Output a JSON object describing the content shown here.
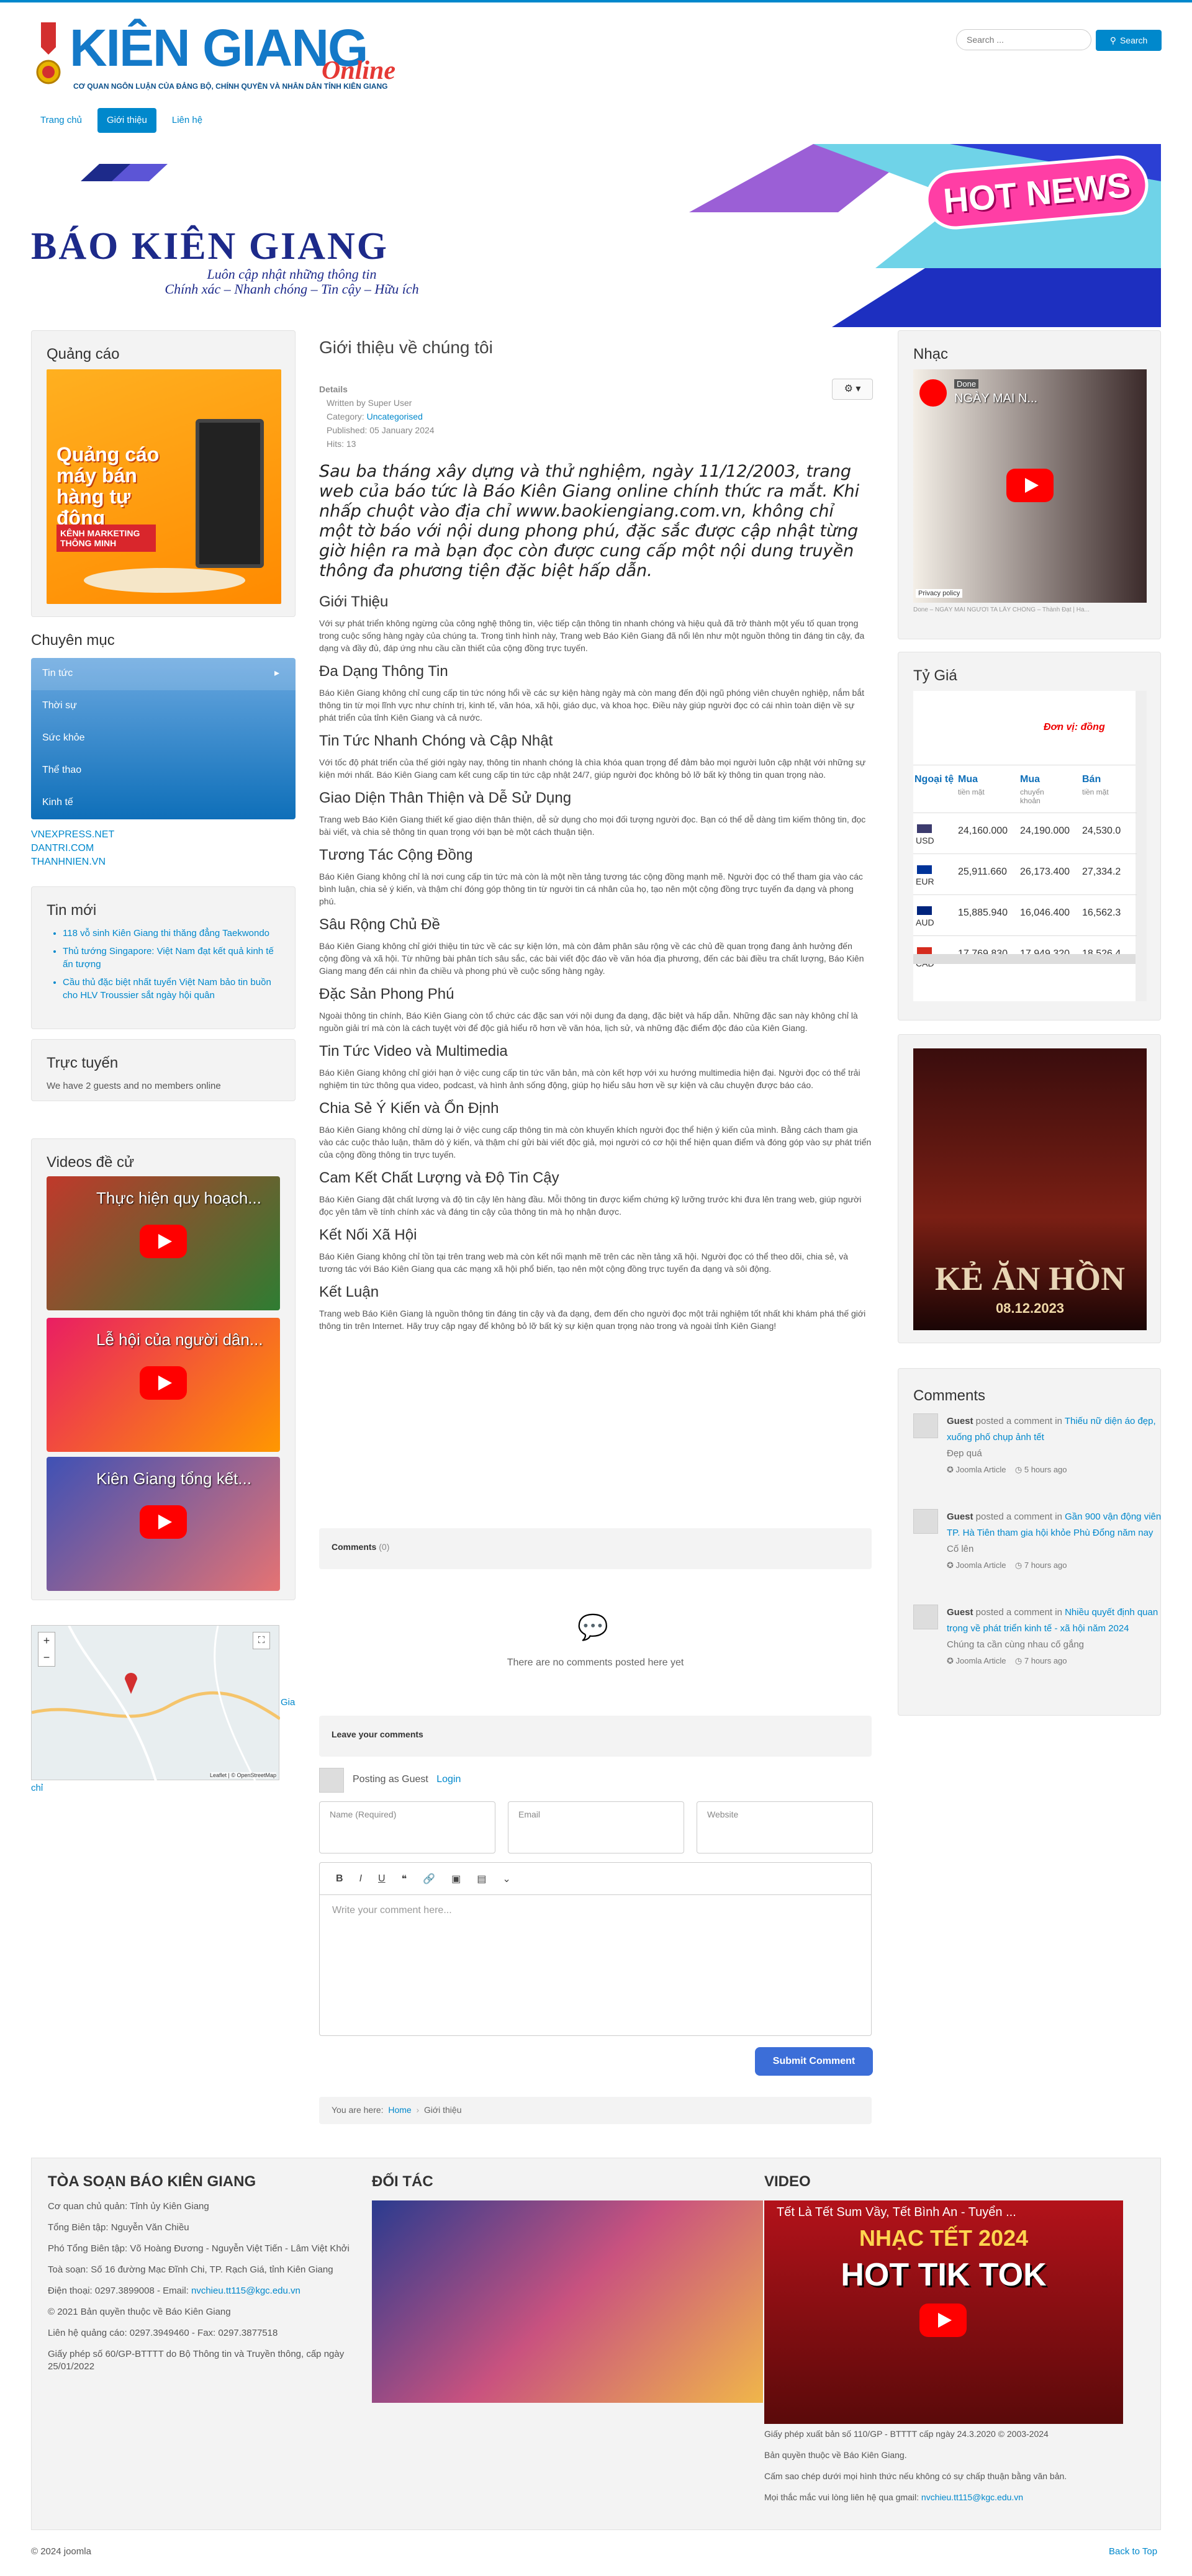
{
  "header": {
    "logo_text": "KIÊN GIANG",
    "logo_online": "Online",
    "logo_subtitle": "CƠ QUAN NGÔN LUẬN CỦA ĐẢNG BỘ, CHÍNH QUYỀN VÀ NHÂN DÂN TỈNH KIÊN GIANG",
    "search_placeholder": "Search ...",
    "search_button": "Search"
  },
  "nav": {
    "items": [
      "Trang chủ",
      "Giới thiệu",
      "Liên hệ"
    ],
    "active": "Giới thiệu"
  },
  "banner": {
    "title": "BÁO KIÊN GIANG",
    "line1": "Luôn cập nhật những thông tin",
    "line2": "Chính xác – Nhanh chóng – Tin cậy – Hữu ích",
    "hot": "HOT NEWS"
  },
  "left": {
    "ads_title": "Quảng cáo",
    "ads_image_text": "Quảng cáo máy bán hàng tự động",
    "ads_image_sub": "KÊNH MARKETING THÔNG MINH",
    "categories_title": "Chuyên mục",
    "categories": [
      "Tin tức",
      "Thời sự",
      "Sức khỏe",
      "Thể thao",
      "Kinh tế"
    ],
    "links": [
      "VNEXPRESS.NET",
      "DANTRI.COM",
      "THANHNIEN.VN"
    ],
    "news_title": "Tin mới",
    "news": [
      "118 vỗ sinh Kiên Giang thi thăng đẳng Taekwondo",
      "Thủ tướng Singapore: Việt Nam đạt kết quả kinh tế ấn tượng",
      "Cầu thủ đặc biệt nhất tuyển Việt Nam bảo tin buồn cho HLV Troussier sắt ngày hội quân"
    ],
    "online_title": "Trực tuyến",
    "online_text": "We have 2 guests and no members online",
    "videos_title": "Videos đề cử",
    "videos": [
      "Thực hiện quy hoạch...",
      "Lễ hội của người dân...",
      "Kiên Giang tổng kết..."
    ],
    "map_label": "Gia",
    "map_label2": "chỉ",
    "map_attr": "Leaflet | © OpenStreetMap"
  },
  "article": {
    "title": "Giới thiệu về chúng tôi",
    "details_label": "Details",
    "written_by": "Written by Super User",
    "category_label": "Category: ",
    "category": "Uncategorised",
    "published": "Published: 05 January 2024",
    "hits": "Hits: 13",
    "intro": "Sau ba tháng xây dựng và thử nghiệm, ngày 11/12/2003, trang web của báo tức là Báo Kiên Giang online chính thức ra mắt. Khi nhấp chuột vào địa chỉ www.baokiengiang.com.vn, không chỉ một tờ báo với nội dung phong phú, đặc sắc được cập nhật từng giờ hiện ra mà bạn đọc còn được cung cấp một nội dung truyền thông đa phương tiện đặc biệt hấp dẫn.",
    "sections": [
      {
        "h": "Giới Thiệu",
        "p": "Với sự phát triển không ngừng của công nghệ thông tin, việc tiếp cận thông tin nhanh chóng và hiệu quả đã trở thành một yếu tố quan trọng trong cuộc sống hàng ngày của chúng ta. Trong tình hình này, Trang web Báo Kiên Giang đã nổi lên như một nguồn thông tin đáng tin cậy, đa dạng và đầy đủ, đáp ứng nhu cầu cần thiết của cộng đồng trực tuyến."
      },
      {
        "h": "Đa Dạng Thông Tin",
        "p": "Báo Kiên Giang không chỉ cung cấp tin tức nóng hổi về các sự kiện hàng ngày mà còn mang đến đội ngũ phóng viên chuyên nghiệp, nắm bắt thông tin từ mọi lĩnh vực như chính trị, kinh tế, văn hóa, xã hội, giáo dục, và khoa học. Điều này giúp người đọc có cái nhìn toàn diện về sự phát triển của tỉnh Kiên Giang và cả nước."
      },
      {
        "h": "Tin Tức Nhanh Chóng và Cập Nhật",
        "p": "Với tốc độ phát triển của thế giới ngày nay, thông tin nhanh chóng là chìa khóa quan trọng để đảm bảo mọi người luôn cập nhật với những sự kiện mới nhất. Báo Kiên Giang cam kết cung cấp tin tức cập nhật 24/7, giúp người đọc không bỏ lỡ bất kỳ thông tin quan trọng nào."
      },
      {
        "h": "Giao Diện Thân Thiện và Dễ Sử Dụng",
        "p": "Trang web Báo Kiên Giang thiết kế giao diện thân thiện, dễ sử dụng cho mọi đối tượng người đọc. Bạn có thể dễ dàng tìm kiếm thông tin, đọc bài viết, và chia sẻ thông tin quan trọng với bạn bè một cách thuận tiện."
      },
      {
        "h": "Tương Tác Cộng Đồng",
        "p": "Báo Kiên Giang không chỉ là nơi cung cấp tin tức mà còn là một nền tảng tương tác cộng đồng mạnh mẽ. Người đọc có thể tham gia vào các bình luận, chia sẻ ý kiến, và thậm chí đóng góp thông tin từ người tin cá nhân của họ, tạo nên một cộng đồng trực tuyến đa dạng và phong phú."
      },
      {
        "h": "Sâu Rộng Chủ Đề",
        "p": "Báo Kiên Giang không chỉ giới thiệu tin tức về các sự kiện lớn, mà còn đảm phân sâu rộng về các chủ đề quan trọng đang ảnh hưởng đến cộng đồng và xã hội. Từ những bài phân tích sâu sắc, các bài viết độc đáo về văn hóa địa phương, đến các bài điều tra chất lượng, Báo Kiên Giang mang đến cái nhìn đa chiều và phong phú về cuộc sống hàng ngày."
      },
      {
        "h": "Đặc Sản Phong Phú",
        "p": "Ngoài thông tin chính, Báo Kiên Giang còn tổ chức các đặc san với nội dung đa dạng, đặc biệt và hấp dẫn. Những đặc san này không chỉ là nguồn giải trí mà còn là cách tuyệt vời để độc giả hiểu rõ hơn về văn hóa, lịch sử, và những đặc điểm độc đáo của Kiên Giang."
      },
      {
        "h": "Tin Tức Video và Multimedia",
        "p": "Báo Kiên Giang không chỉ giới hạn ở việc cung cấp tin tức văn bản, mà còn kết hợp với xu hướng multimedia hiện đại. Người đọc có thể trải nghiệm tin tức thông qua video, podcast, và hình ảnh sống động, giúp họ hiểu sâu hơn về sự kiện và câu chuyện được báo cáo."
      },
      {
        "h": "Chia Sẻ Ý Kiến và Ổn Định",
        "p": "Báo Kiên Giang không chỉ dừng lại ở việc cung cấp thông tin mà còn khuyến khích người đọc thể hiện ý kiến của mình. Bằng cách tham gia vào các cuộc thảo luận, thăm dò ý kiến, và thậm chí gửi bài viết độc giả, mọi người có cơ hội thể hiện quan điểm và đóng góp vào sự phát triển của cộng đồng thông tin trực tuyến."
      },
      {
        "h": "Cam Kết Chất Lượng và Độ Tin Cậy",
        "p": "Báo Kiên Giang đặt chất lượng và độ tin cậy lên hàng đầu. Mỗi thông tin được kiểm chứng kỹ lưỡng trước khi đưa lên trang web, giúp người đọc yên tâm về tính chính xác và đáng tin cậy của thông tin mà họ nhận được."
      },
      {
        "h": "Kết Nối Xã Hội",
        "p": "Báo Kiên Giang không chỉ tồn tại trên trang web mà còn kết nối mạnh mẽ trên các nền tảng xã hội. Người đọc có thể theo dõi, chia sẻ, và tương tác với Báo Kiên Giang qua các mạng xã hội phổ biến, tạo nên một cộng đồng trực tuyến đa dạng và sôi động."
      },
      {
        "h": "Kết Luận",
        "p": "Trang web Báo Kiên Giang là nguồn thông tin đáng tin cậy và đa dạng, đem đến cho người đọc một trải nghiệm tốt nhất khi khám phá thế giới thông tin trên Internet. Hãy truy cập ngay để không bỏ lỡ bất kỳ sự kiện quan trọng nào trong và ngoài tỉnh Kiên Giang!"
      }
    ],
    "comments_label": "Comments",
    "comments_count": "(0)",
    "no_comments": "There are no comments posted here yet",
    "leave_comment": "Leave your comments",
    "posting_as": "Posting as Guest",
    "login": "Login",
    "name_placeholder": "Name (Required)",
    "email_placeholder": "Email",
    "website_placeholder": "Website",
    "comment_placeholder": "Write your comment here...",
    "submit": "Submit Comment",
    "breadcrumb_prefix": "You are here:",
    "breadcrumb_home": "Home",
    "breadcrumb_current": "Giới thiệu"
  },
  "right": {
    "music_title": "Nhạc",
    "music_video": "NGÀY MAI N...",
    "music_done": "Done",
    "privacy": "Privacy policy",
    "music_caption": "Done – NGÀY MAI NGƯỜI TA LẤY CHỒNG – Thành Đạt | Ha...",
    "rates_title": "Tỷ Giá",
    "unit": "Đơn vị: đồng",
    "head_cur": "Ngoại tệ",
    "head_buy": "Mua",
    "head_buy_sub": "tiền mặt",
    "head_transfer": "Mua",
    "head_transfer_sub": "chuyển khoản",
    "head_sell": "Bán",
    "head_sell_sub": "tiền mặt",
    "rates": [
      {
        "code": "USD",
        "buy": "24,160.000",
        "transfer": "24,190.000",
        "sell": "24,530.0"
      },
      {
        "code": "EUR",
        "buy": "25,911.660",
        "transfer": "26,173.400",
        "sell": "27,334.2"
      },
      {
        "code": "AUD",
        "buy": "15,885.940",
        "transfer": "16,046.400",
        "sell": "16,562.3"
      },
      {
        "code": "CAD",
        "buy": "17,769.830",
        "transfer": "17,949.320",
        "sell": "18,526.4"
      }
    ],
    "poster_title": "KẺ ĂN HỒN",
    "poster_date": "08.12.2023",
    "comments_title": "Comments",
    "comments": [
      {
        "author": "Guest",
        "action": " posted a comment in ",
        "link": "Thiếu nữ diện áo đẹp, xuống phố chụp ảnh tết",
        "text": "Đẹp quá",
        "source": "Joomla Article",
        "time": "5 hours ago"
      },
      {
        "author": "Guest",
        "action": " posted a comment in ",
        "link": "Gần 900 vận động viên TP. Hà Tiên tham gia hội khỏe Phù Đổng năm nay",
        "text": "Cố lên",
        "source": "Joomla Article",
        "time": "7 hours ago"
      },
      {
        "author": "Guest",
        "action": " posted a comment in ",
        "link": "Nhiều quyết định quan trọng về phát triển kinh tế - xã hội năm 2024",
        "text": "Chúng ta cần cùng nhau cố gắng",
        "source": "Joomla Article",
        "time": "7 hours ago"
      }
    ]
  },
  "footer": {
    "office_title": "TÒA SOẠN BÁO KIÊN GIANG",
    "office_lines": [
      "Cơ quan chủ quản: Tỉnh ủy Kiên Giang",
      "Tổng Biên tập: Nguyễn Văn Chiều",
      "Phó Tổng Biên tập: Võ Hoàng Đương - Nguyễn Việt Tiến - Lâm Việt Khởi",
      "Toà soạn: Số 16 đường Mạc Đĩnh Chi, TP. Rạch Giá, tỉnh Kiên Giang"
    ],
    "phone": "Điện thoại: 0297.3899008 - Email: ",
    "email": "nvchieu.tt115@kgc.edu.vn",
    "office_lines2": [
      "© 2021 Bản quyền thuộc về Báo Kiên Giang",
      "Liên hệ quảng cáo: 0297.3949460 - Fax: 0297.3877518",
      "Giấy phép số 60/GP-BTTTT do Bộ Thông tin và Truyền thông, cấp ngày 25/01/2022"
    ],
    "partner_title": "ĐỐI TÁC",
    "video_title": "VIDEO",
    "video_caption": "Tết Là Tết Sum Vầy, Tết Bình An - Tuyển ...",
    "video_banner": "NHẠC TẾT 2024",
    "video_hot": "HOT TIK TOK",
    "video_lines": [
      "Giấy phép xuất bản số 110/GP - BTTTT cấp ngày 24.3.2020 ©   2003-2024",
      "Bản quyền thuộc về Báo Kiên Giang.",
      "Cấm sao chép dưới mọi hình thức nếu không có sự chấp thuận   bằng văn bản."
    ],
    "contact": "Mọi thắc mắc vui lòng liên hệ qua gmail:   ",
    "contact_email": "nvchieu.tt115@kgc.edu.vn",
    "copyright": "© 2024 joomla",
    "back_to_top": "Back to Top"
  }
}
